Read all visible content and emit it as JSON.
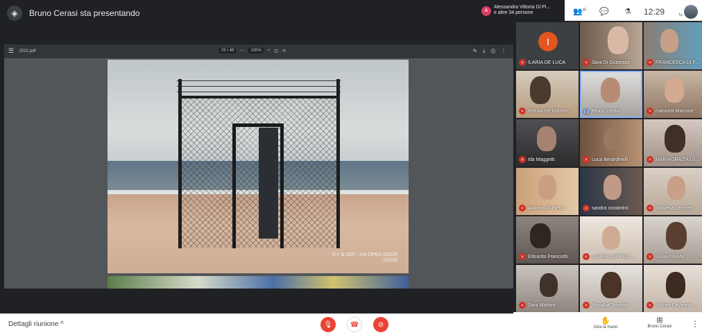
{
  "presentation": {
    "title": "Bruno Cerasi sta presentando",
    "pdf": {
      "menu_icon": "☰",
      "file_name": "2021.pdf",
      "page": "25 / 48",
      "zoom_out": "—",
      "zoom": "100%",
      "zoom_in": "+",
      "fit_icon": "◫",
      "rotate_icon": "⟲",
      "edit_icon": "✎",
      "download_icon": "⤓",
      "print_icon": "⎙",
      "more_icon": "⋮"
    },
    "slide_caption_line1": "ICY & SOT - AN OPEN DOOR",
    "slide_caption_line2": "(2018)"
  },
  "presenter_chip": {
    "avatar_letter": "A",
    "line1": "Alessandra Vittoria Di Pi...",
    "line2": "e altre 34 persone"
  },
  "toolbar": {
    "people_icon": "👥",
    "people_count": "35",
    "chat_icon": "💬",
    "activities_icon": "⚗",
    "time": "12:29",
    "me_label": "Tu"
  },
  "tiles": [
    {
      "name": "ILARIA DE LUCA",
      "muted": true,
      "avatar_letter": "I"
    },
    {
      "name": "Sara Di Giuseppe",
      "muted": true
    },
    {
      "name": "FRANCESCA DI F...",
      "muted": true
    },
    {
      "name": "Kirenia De Domen...",
      "muted": true
    },
    {
      "name": "Bruno Cerasi",
      "muted": false
    },
    {
      "name": "manuela Marrone",
      "muted": true
    },
    {
      "name": "Ida Maggetti",
      "muted": true
    },
    {
      "name": "Luca Berardinelli",
      "muted": true
    },
    {
      "name": "MARIAGRAZIA DI ...",
      "muted": true
    },
    {
      "name": "Arianna Di Pietro",
      "muted": true
    },
    {
      "name": "sandra costantini",
      "muted": true
    },
    {
      "name": "Marilena Leonetti",
      "muted": true
    },
    {
      "name": "Edoardo Franciotti",
      "muted": true
    },
    {
      "name": "LAURA CAPPELL...",
      "muted": true
    },
    {
      "name": "GAIA PIRANI",
      "muted": true
    },
    {
      "name": "Sara Mattoni",
      "muted": true
    },
    {
      "name": "Rosalba Tennina",
      "muted": true
    },
    {
      "name": "Micheli Dayanna ...",
      "muted": true
    }
  ],
  "bottom": {
    "details": "Dettagli riunione",
    "details_chevron": "^",
    "mic_icon": "🎙",
    "end_icon": "☎",
    "cam_icon": "⊘",
    "raise_hand_icon": "✋",
    "raise_hand_label": "Alza la mano",
    "present_icon": "⊞",
    "present_label": "Bruno Cerasi",
    "more_icon": "⋮"
  },
  "colors": {
    "accent_red": "#ea4335",
    "stage_bg": "#202124",
    "pdf_bg": "#525659"
  }
}
